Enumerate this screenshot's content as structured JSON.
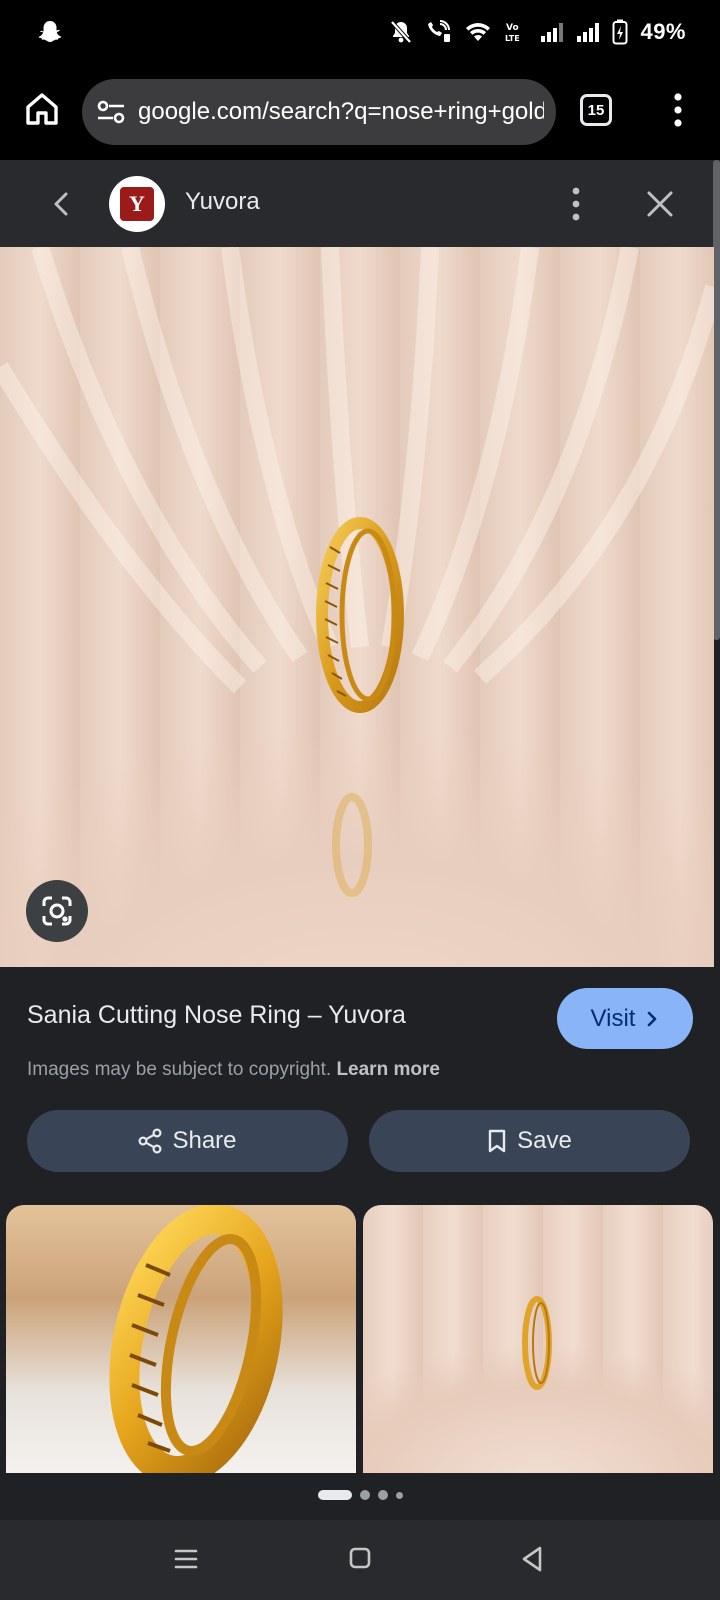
{
  "status_bar": {
    "battery_percent": "49%",
    "icons": [
      "snapchat-icon",
      "mute-icon",
      "wifi-calling-icon",
      "wifi-icon",
      "volte-icon",
      "signal-icon",
      "signal-icon",
      "battery-charging-icon"
    ]
  },
  "browser": {
    "url": "google.com/search?q=nose+ring+gold&",
    "tab_count": "15"
  },
  "source": {
    "name": "Yuvora",
    "logo_letter": "Y"
  },
  "result": {
    "title": "Sania Cutting Nose Ring – Yuvora",
    "visit_label": "Visit",
    "copyright_text": "Images may be subject to copyright.",
    "learn_more_label": "Learn more",
    "share_label": "Share",
    "save_label": "Save"
  },
  "carousel": {
    "page_count": 4,
    "active_index": 0
  },
  "colors": {
    "accent": "#8ab4f8",
    "pill": "#394457",
    "background": "#202124"
  }
}
